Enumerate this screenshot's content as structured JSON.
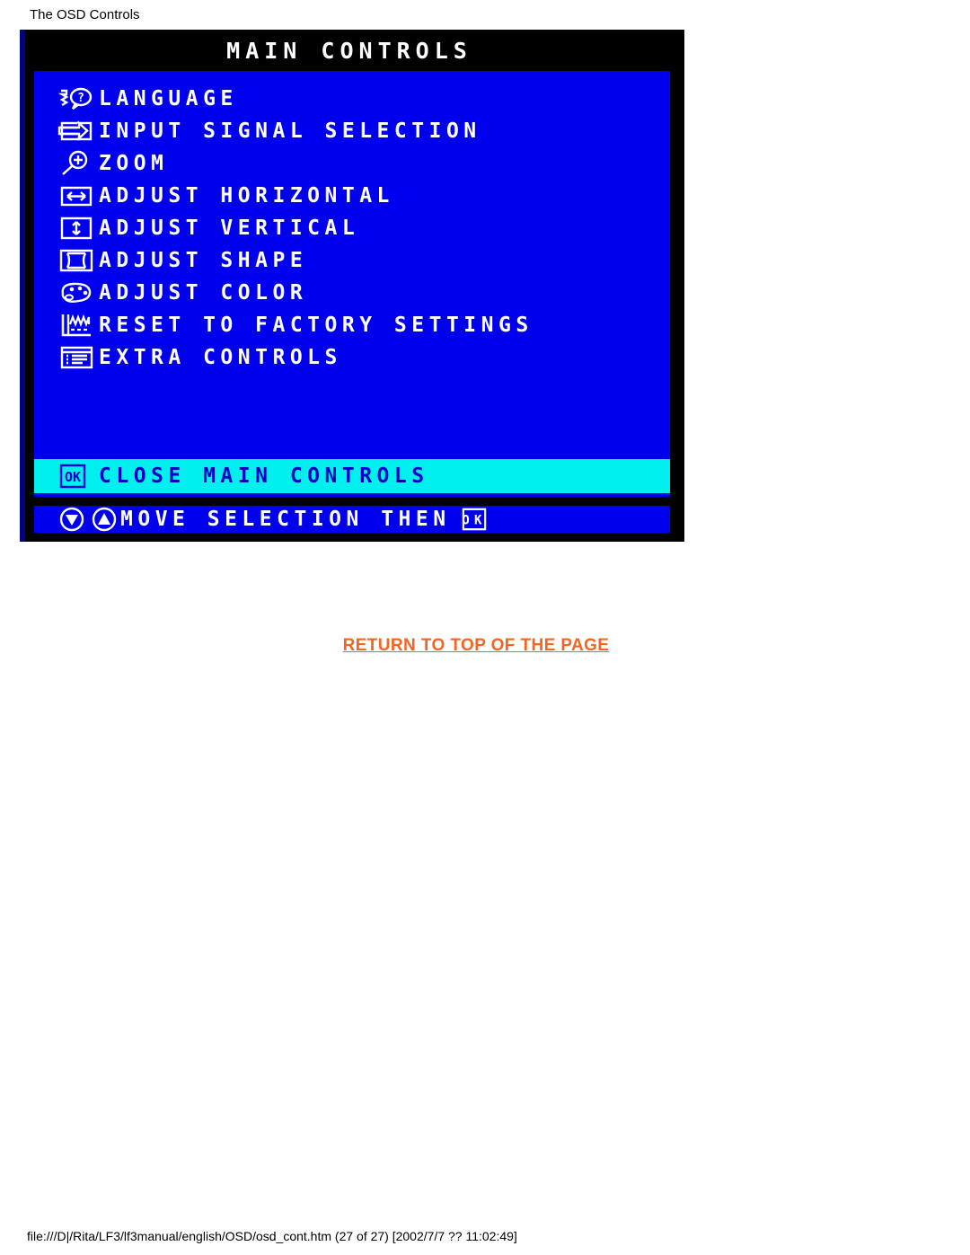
{
  "page": {
    "heading": "The OSD Controls",
    "return_link": "RETURN TO TOP OF THE PAGE",
    "file_footer": "file:///D|/Rita/LF3/lf3manual/english/OSD/osd_cont.htm (27 of 27) [2002/7/7 ?? 11:02:49]"
  },
  "osd": {
    "title": "MAIN CONTROLS",
    "background_color": "#0000ee",
    "title_background_color": "#000000",
    "highlight_background_color": "#00f0f0",
    "highlight_text_color": "#0000cc",
    "text_color": "#ffffff",
    "items": [
      {
        "label": "LANGUAGE",
        "icon": "language-face-question-icon"
      },
      {
        "label": "INPUT SIGNAL SELECTION",
        "icon": "input-signal-arrow-icon"
      },
      {
        "label": "ZOOM",
        "icon": "magnifier-plus-icon"
      },
      {
        "label": "ADJUST HORIZONTAL",
        "icon": "horizontal-arrows-icon"
      },
      {
        "label": "ADJUST VERTICAL",
        "icon": "vertical-arrows-icon"
      },
      {
        "label": "ADJUST SHAPE",
        "icon": "shape-pincushion-icon"
      },
      {
        "label": "ADJUST COLOR",
        "icon": "color-palette-icon"
      },
      {
        "label": "RESET TO FACTORY SETTINGS",
        "icon": "factory-reset-icon"
      },
      {
        "label": "EXTRA CONTROLS",
        "icon": "extra-controls-list-icon"
      }
    ],
    "highlighted_item": {
      "label": "CLOSE MAIN CONTROLS",
      "icon": "ok-button-icon"
    },
    "footer_hint": {
      "label": "MOVE SELECTION THEN",
      "icons": [
        "down-arrow-button-icon",
        "up-arrow-button-icon",
        "ok-button-icon"
      ]
    }
  }
}
